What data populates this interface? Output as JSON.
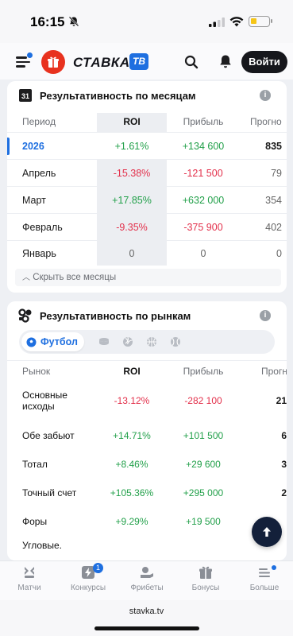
{
  "status_bar": {
    "time": "16:15"
  },
  "header": {
    "logo_text": "СТАВКА",
    "logo_badge": "ТВ",
    "login_label": "Войти"
  },
  "monthly": {
    "title": "Результативность по месяцам",
    "icon_label": "31",
    "columns": {
      "period": "Период",
      "roi": "ROI",
      "profit": "Прибыль",
      "forecasts": "Прогно"
    },
    "rows": [
      {
        "label": "2026",
        "roi": "+1.61%",
        "profit": "+134 600",
        "forecasts": "835"
      },
      {
        "label": "Апрель",
        "roi": "-15.38%",
        "profit": "-121 500",
        "forecasts": "79"
      },
      {
        "label": "Март",
        "roi": "+17.85%",
        "profit": "+632 000",
        "forecasts": "354"
      },
      {
        "label": "Февраль",
        "roi": "-9.35%",
        "profit": "-375 900",
        "forecasts": "402"
      },
      {
        "label": "Январь",
        "roi": "0",
        "profit": "0",
        "forecasts": "0"
      }
    ],
    "collapse_label": "Скрыть все месяцы"
  },
  "markets": {
    "title": "Результативность по рынкам",
    "active_sport": "Футбол",
    "columns": {
      "market": "Рынок",
      "roi": "ROI",
      "profit": "Прибыль",
      "forecasts": "Прогн"
    },
    "rows": [
      {
        "label": "Основные исходы",
        "roi": "-13.12%",
        "profit": "-282 100",
        "forecasts": "21"
      },
      {
        "label": "Обе забьют",
        "roi": "+14.71%",
        "profit": "+101 500",
        "forecasts": "6"
      },
      {
        "label": "Тотал",
        "roi": "+8.46%",
        "profit": "+29 600",
        "forecasts": "3"
      },
      {
        "label": "Точный счет",
        "roi": "+105.36%",
        "profit": "+295 000",
        "forecasts": "2"
      },
      {
        "label": "Форы",
        "roi": "+9.29%",
        "profit": "+19 500",
        "forecasts": ""
      },
      {
        "label": "Угловые.",
        "roi": "",
        "profit": "",
        "forecasts": ""
      }
    ]
  },
  "bottom_nav": {
    "items": [
      {
        "label": "Матчи"
      },
      {
        "label": "Конкурсы",
        "badge": "1"
      },
      {
        "label": "Фрибеты"
      },
      {
        "label": "Бонусы"
      },
      {
        "label": "Больше"
      }
    ]
  },
  "browser": {
    "url": "stavka.tv"
  },
  "colors": {
    "accent": "#1e6fe0",
    "positive": "#22a04a",
    "negative": "#e3304b",
    "dark": "#16171c"
  }
}
